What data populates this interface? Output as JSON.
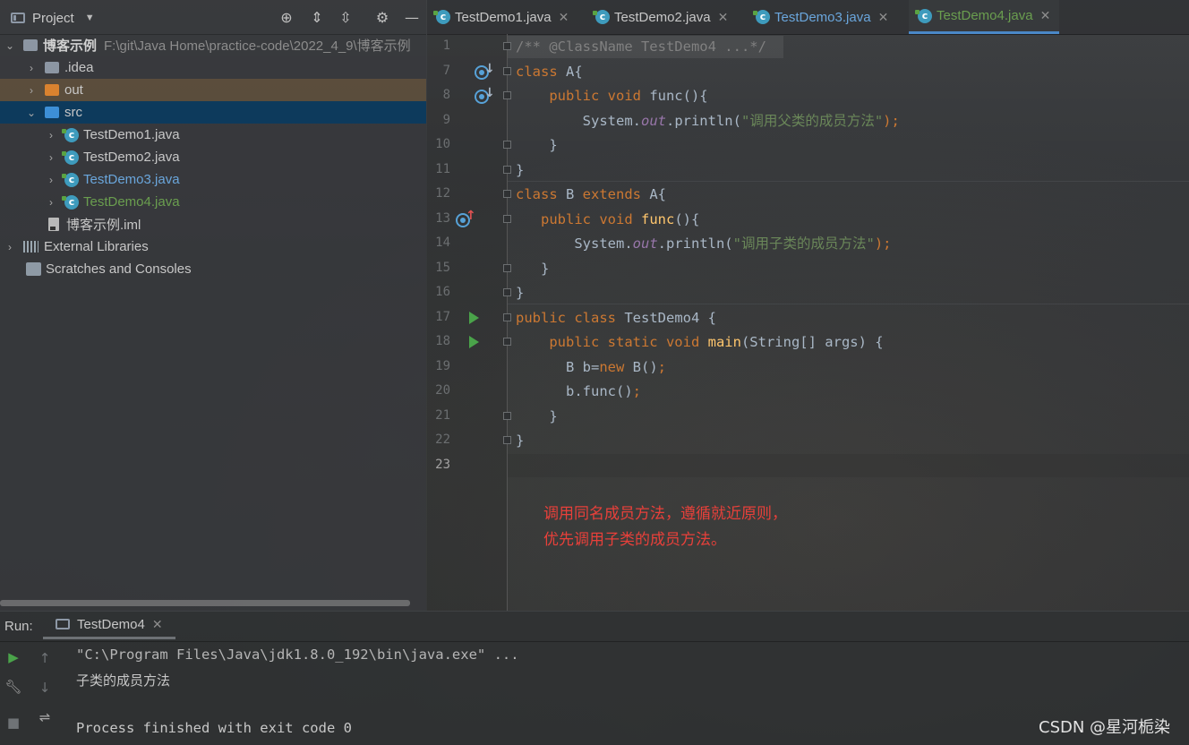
{
  "project_panel": {
    "title": "Project",
    "tools": [
      "locate-icon",
      "expand-all-icon",
      "collapse-all-icon",
      "gear-icon",
      "minimize-icon"
    ],
    "tree": {
      "root_name": "博客示例",
      "root_path": "F:\\git\\Java Home\\practice-code\\2022_4_9\\博客示例",
      "idea": ".idea",
      "out": "out",
      "src": "src",
      "files": [
        "TestDemo1.java",
        "TestDemo2.java",
        "TestDemo3.java",
        "TestDemo4.java"
      ],
      "iml": "博客示例.iml",
      "external_libraries": "External Libraries",
      "scratches": "Scratches and Consoles"
    }
  },
  "editor": {
    "tabs": [
      "TestDemo1.java",
      "TestDemo2.java",
      "TestDemo3.java",
      "TestDemo4.java"
    ],
    "active_tab": "TestDemo4.java",
    "line_numbers": [
      "1",
      "7",
      "8",
      "9",
      "10",
      "11",
      "12",
      "13",
      "14",
      "15",
      "16",
      "17",
      "18",
      "19",
      "20",
      "21",
      "22",
      "23"
    ],
    "code": {
      "l1": "/** @ClassName TestDemo4 ...*/",
      "l7_a": "class ",
      "l7_b": "A{",
      "l8_a": "    public void ",
      "l8_b": "func",
      "l8_c": "(){",
      "l9_a": "        System.",
      "l9_b": "out",
      "l9_c": ".println(",
      "l9_d": "\"调用父类的成员方法\"",
      "l9_e": ");",
      "l10": "    }",
      "l11": "}",
      "l12_a": "class ",
      "l12_b": "B ",
      "l12_c": "extends ",
      "l12_d": "A{",
      "l13_a": "   public void ",
      "l13_b": "func",
      "l13_c": "(){",
      "l14_a": "       System.",
      "l14_b": "out",
      "l14_c": ".println(",
      "l14_d": "\"调用子类的成员方法\"",
      "l14_e": ");",
      "l15": "   }",
      "l16": "}",
      "l17_a": "public class ",
      "l17_b": "TestDemo4 {",
      "l18_a": "    public static void ",
      "l18_b": "main",
      "l18_c": "(String[] args) {",
      "l19_a": "      B b=",
      "l19_b": "new ",
      "l19_c": "B()",
      "l19_d": ";",
      "l20_a": "      b.func()",
      "l20_b": ";",
      "l21": "    }",
      "l22": "}"
    },
    "note_line1": "调用同名成员方法，遵循就近原则，",
    "note_line2": "优先调用子类的成员方法。"
  },
  "run_panel": {
    "label": "Run:",
    "tab": "TestDemo4",
    "output": {
      "command": "\"C:\\Program Files\\Java\\jdk1.8.0_192\\bin\\java.exe\" ...",
      "line1": "子类的成员方法",
      "line2": "",
      "line3": "Process finished with exit code 0"
    }
  },
  "watermark": "CSDN @星河栀染",
  "colors": {
    "keyword": "#cc7832",
    "method": "#ffc66d",
    "string": "#6a8759",
    "static_field": "#9876aa",
    "note": "#e8403a",
    "selection": "#0d3a5c",
    "active_tab_text": "#6a9e4f"
  }
}
